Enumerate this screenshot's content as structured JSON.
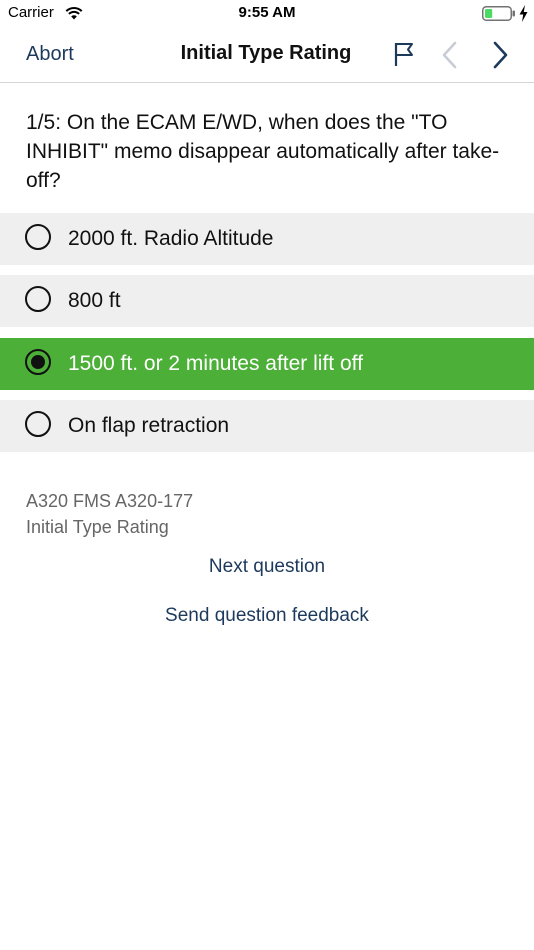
{
  "status_bar": {
    "carrier": "Carrier",
    "time": "9:55 AM",
    "battery_level": 0.3,
    "battery_color": "#4cd964"
  },
  "nav": {
    "abort_label": "Abort",
    "title": "Initial Type Rating",
    "icons": [
      "flag-icon",
      "chevron-left-icon",
      "chevron-right-icon"
    ],
    "link_color": "#1d3a5c"
  },
  "question": {
    "text": "1/5: On the ECAM E/WD, when does the \"TO INHIBIT\" memo disappear automatically after take-off?"
  },
  "answers": [
    {
      "label": "2000 ft. Radio Altitude",
      "selected": false
    },
    {
      "label": "800 ft",
      "selected": false
    },
    {
      "label": "1500 ft. or 2 minutes after lift off",
      "selected": true
    },
    {
      "label": "On flap retraction",
      "selected": false
    }
  ],
  "colors": {
    "answer_bg": "#efefef",
    "answer_selected_bg": "#4caf37"
  },
  "meta": {
    "source": "A320 FMS A320-177",
    "course": "Initial Type Rating"
  },
  "actions": {
    "next_label": "Next question",
    "feedback_label": "Send question feedback"
  }
}
